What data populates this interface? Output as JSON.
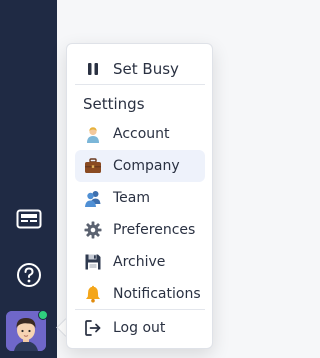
{
  "menu": {
    "busy_label": "Set Busy",
    "settings_heading": "Settings",
    "items": [
      {
        "label": "Account",
        "icon": "person-icon"
      },
      {
        "label": "Company",
        "icon": "briefcase-icon"
      },
      {
        "label": "Team",
        "icon": "team-icon"
      },
      {
        "label": "Preferences",
        "icon": "gear-icon"
      },
      {
        "label": "Archive",
        "icon": "floppy-disk-icon"
      },
      {
        "label": "Notifications",
        "icon": "bell-icon"
      }
    ],
    "logout_label": "Log out",
    "selected_item": "Company"
  },
  "rail": {
    "status": "online"
  },
  "colors": {
    "rail_bg": "#1f2a44",
    "avatar_bg": "#6f67c9",
    "online_dot": "#2fd07e",
    "selected_row_bg": "#eef2fb"
  }
}
